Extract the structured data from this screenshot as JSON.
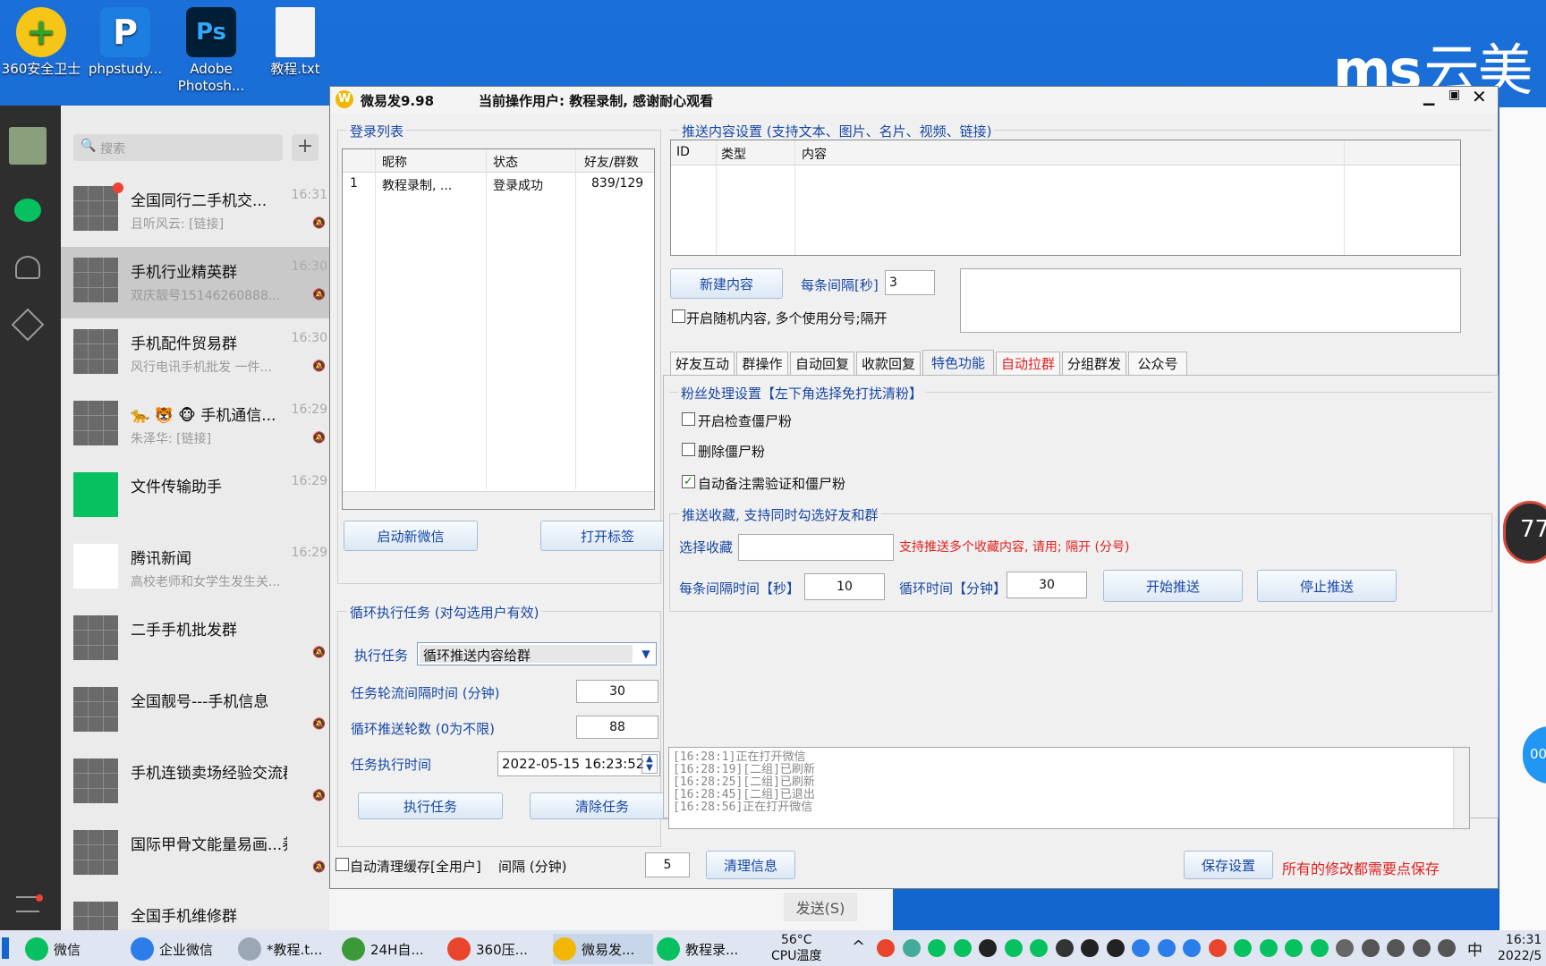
{
  "desktop": {
    "icons": [
      {
        "label": "360安全卫士",
        "glyph": "+"
      },
      {
        "label": "phpstudy...",
        "glyph": "P"
      },
      {
        "label": "Adobe Photosh...",
        "glyph": "Ps"
      },
      {
        "label": "教程.txt",
        "glyph": ""
      }
    ],
    "brand": "云美",
    "brand_mark": "ms",
    "badge_77": "77",
    "badge_00": "00:"
  },
  "wechat": {
    "search_placeholder": "搜索",
    "add": "+",
    "send_label": "发送(S)",
    "chats": [
      {
        "name": "全国同行二手机交...",
        "time": "16:31",
        "preview": "且听风云: [链接]"
      },
      {
        "name": "手机行业精英群",
        "time": "16:30",
        "preview": "双庆靓号15146260888..."
      },
      {
        "name": "手机配件贸易群",
        "time": "16:30",
        "preview": "风行电讯手机批发  一件..."
      },
      {
        "name": "🐆 🐯 🐵 手机通信...",
        "time": "16:29",
        "preview": "朱泽华: [链接]"
      },
      {
        "name": "文件传输助手",
        "time": "16:29",
        "preview": ""
      },
      {
        "name": "腾讯新闻",
        "time": "16:29",
        "preview": "高校老师和女学生发生关..."
      },
      {
        "name": "二手手机批发群",
        "time": "",
        "preview": ""
      },
      {
        "name": "全国靓号---手机信息",
        "time": "",
        "preview": ""
      },
      {
        "name": "手机连锁卖场经验交流群",
        "time": "",
        "preview": ""
      },
      {
        "name": "国际甲骨文能量易画...养...",
        "time": "",
        "preview": ""
      },
      {
        "name": "全国手机维修群",
        "time": "",
        "preview": ""
      }
    ]
  },
  "app": {
    "title": "微易发9.98",
    "current_user": "当前操作用户: 教程录制, 感谢耐心观看",
    "login": {
      "caption": "登录列表",
      "headers": [
        "",
        "昵称",
        "状态",
        "好友/群数"
      ],
      "rows": [
        [
          "1",
          "教程录制, ...",
          "登录成功",
          "839/129"
        ]
      ],
      "btn_new": "启动新微信",
      "btn_tag": "打开标签"
    },
    "loop": {
      "caption": "循环执行任务 (对勾选用户有效)",
      "task_label": "执行任务",
      "task_value": "循环推送内容给群",
      "interval_label": "任务轮流间隔时间 (分钟)",
      "interval_value": "30",
      "rounds_label": "循环推送轮数 (0为不限)",
      "rounds_value": "88",
      "time_label": "任务执行时间",
      "time_value": "2022-05-15 16:23:52",
      "btn_exec": "执行任务",
      "btn_clear": "清除任务"
    },
    "auto_clean": {
      "label": "自动清理缓存[全用户]",
      "interval_label": "间隔 (分钟)",
      "value": "5"
    },
    "push": {
      "caption": "推送内容设置 (支持文本、图片、名片、视频、链接)",
      "headers": [
        "ID",
        "类型",
        "内容",
        ""
      ],
      "btn_new": "新建内容",
      "interval_label": "每条间隔[秒]",
      "interval_value": "3",
      "random_label": "开启随机内容, 多个使用分号;隔开"
    },
    "tabs": [
      "好友互动",
      "群操作",
      "自动回复",
      "收款回复",
      "特色功能",
      "自动拉群",
      "分组群发",
      "公众号"
    ],
    "fans": {
      "caption": "粉丝处理设置【左下角选择免打扰清粉】",
      "opt1": "开启检查僵尸粉",
      "opt2": "删除僵尸粉",
      "opt3": "自动备注需验证和僵尸粉"
    },
    "fav": {
      "caption": "推送收藏, 支持同时勾选好友和群",
      "select_label": "选择收藏",
      "hint": "支持推送多个收藏内容, 请用; 隔开 (分号)",
      "each_label": "每条间隔时间【秒】",
      "each_value": "10",
      "loop_label": "循环时间【分钟】",
      "loop_value": "30",
      "btn_start": "开始推送",
      "btn_stop": "停止推送"
    },
    "log": [
      "[16:28:1]正在打开微信",
      "[16:28:19][二组]已刷新",
      "[16:28:25][二组]已刷新",
      "[16:28:45][二组]已退出",
      "[16:28:56]正在打开微信"
    ],
    "btn_clear_info": "清理信息",
    "btn_save": "保存设置",
    "save_hint": "所有的修改都需要点保存"
  },
  "taskbar": {
    "items": [
      "微信",
      "企业微信",
      "*教程.t...",
      "24H自...",
      "360压...",
      "微易发...",
      "教程录..."
    ],
    "temp": "56°C",
    "temp_label": "CPU温度",
    "ime": "中",
    "time": "16:31",
    "date": "2022/5"
  },
  "colors": {
    "accent_blue": "#1747a6",
    "red_hint": "#e02020",
    "desktop": "#1466cf"
  }
}
